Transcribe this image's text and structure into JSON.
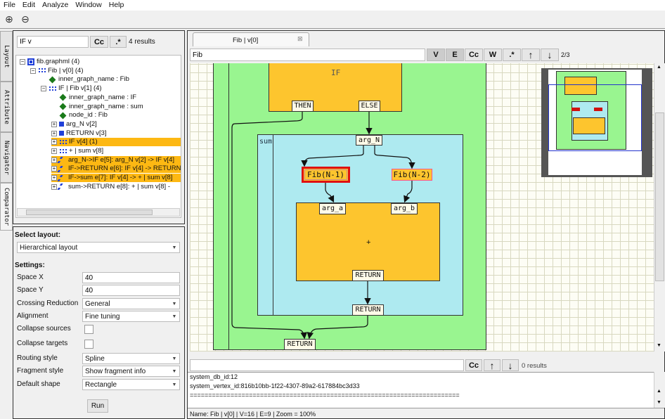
{
  "menu": [
    "File",
    "Edit",
    "Analyze",
    "Window",
    "Help"
  ],
  "side_tabs": [
    "Layout",
    "Attribute",
    "Navigator",
    "Comparator"
  ],
  "search": {
    "value": "IF v",
    "cc": "Cc",
    "regex": ".*",
    "results": "4 results"
  },
  "tree": [
    {
      "label": "fib.graphml (4)",
      "level": 0,
      "toggle": "−",
      "icon": "graph",
      "hl": false
    },
    {
      "label": "Fib | v[0] (4)",
      "level": 1,
      "toggle": "−",
      "icon": "group",
      "hl": false
    },
    {
      "label": "inner_graph_name : Fib",
      "level": 2,
      "toggle": "",
      "icon": "attr",
      "hl": false
    },
    {
      "label": "IF | Fib v[1] (4)",
      "level": 2,
      "toggle": "−",
      "icon": "group",
      "hl": false
    },
    {
      "label": "inner_graph_name : IF",
      "level": 3,
      "toggle": "",
      "icon": "attr",
      "hl": false
    },
    {
      "label": "inner_graph_name : sum",
      "level": 3,
      "toggle": "",
      "icon": "attr",
      "hl": false
    },
    {
      "label": "node_id : Fib",
      "level": 3,
      "toggle": "",
      "icon": "attr",
      "hl": false
    },
    {
      "label": "arg_N v[2]",
      "level": 3,
      "toggle": "+",
      "icon": "node",
      "hl": false
    },
    {
      "label": "RETURN v[3]",
      "level": 3,
      "toggle": "+",
      "icon": "node",
      "hl": false
    },
    {
      "label": "IF v[4] (1)",
      "level": 3,
      "toggle": "+",
      "icon": "group",
      "hl": true
    },
    {
      "label": "+ | sum v[8]",
      "level": 3,
      "toggle": "+",
      "icon": "group",
      "hl": false
    },
    {
      "label": "arg_N->IF e[5]: arg_N v[2] -> IF v[4]",
      "level": 3,
      "toggle": "+",
      "icon": "edge",
      "hl": true
    },
    {
      "label": "IF->RETURN e[6]: IF v[4] -> RETURN",
      "level": 3,
      "toggle": "+",
      "icon": "edge",
      "hl": true
    },
    {
      "label": "IF->sum e[7]: IF v[4] -> + | sum v[8]",
      "level": 3,
      "toggle": "+",
      "icon": "edge",
      "hl": true
    },
    {
      "label": "sum->RETURN e[8]: + | sum v[8] -",
      "level": 3,
      "toggle": "+",
      "icon": "edge",
      "hl": false
    }
  ],
  "layout": {
    "select_label": "Select layout:",
    "layout_value": "Hierarchical layout",
    "settings_label": "Settings:",
    "space_x_label": "Space X",
    "space_x": "40",
    "space_y_label": "Space Y",
    "space_y": "40",
    "crossing_label": "Crossing Reduction",
    "crossing": "General",
    "alignment_label": "Alignment",
    "alignment": "Fine tuning",
    "collapse_sources_label": "Collapse sources",
    "collapse_targets_label": "Collapse targets",
    "routing_label": "Routing style",
    "routing": "Spline",
    "fragment_label": "Fragment style",
    "fragment": "Show fragment info",
    "shape_label": "Default shape",
    "shape": "Rectangle",
    "run": "Run"
  },
  "editor": {
    "tab": "Fib | v[0]",
    "search_value": "Fib",
    "btns": [
      "V",
      "E",
      "Cc",
      "W",
      ".*",
      "↑",
      "↓"
    ],
    "count": "2/3"
  },
  "graph": {
    "if_label": "IF",
    "then": "THEN",
    "else": "ELSE",
    "sum_label": "sum",
    "arg_n": "arg_N",
    "fib1": "Fib(N-1)",
    "fib2": "Fib(N-2)",
    "arg_a": "arg_a",
    "arg_b": "arg_b",
    "plus": "+",
    "return_inner": "RETURN",
    "return_sum": "RETURN",
    "return_outer": "RETURN",
    "colors": {
      "outer": "#99f590",
      "if": "#fdc52e",
      "sum": "#aeeaf0",
      "highlight": "#e01010"
    }
  },
  "bottom": {
    "cc": "Cc",
    "up": "↑",
    "down": "↓",
    "results": "0 results",
    "lines": [
      "system_db_id:12",
      "system_vertex_id:816b10bb-1f22-4307-89a2-617884bc3d33",
      "========================================================================="
    ],
    "status": "Name: Fib | v[0] | V=16 | E=9 | Zoom = 100%"
  }
}
